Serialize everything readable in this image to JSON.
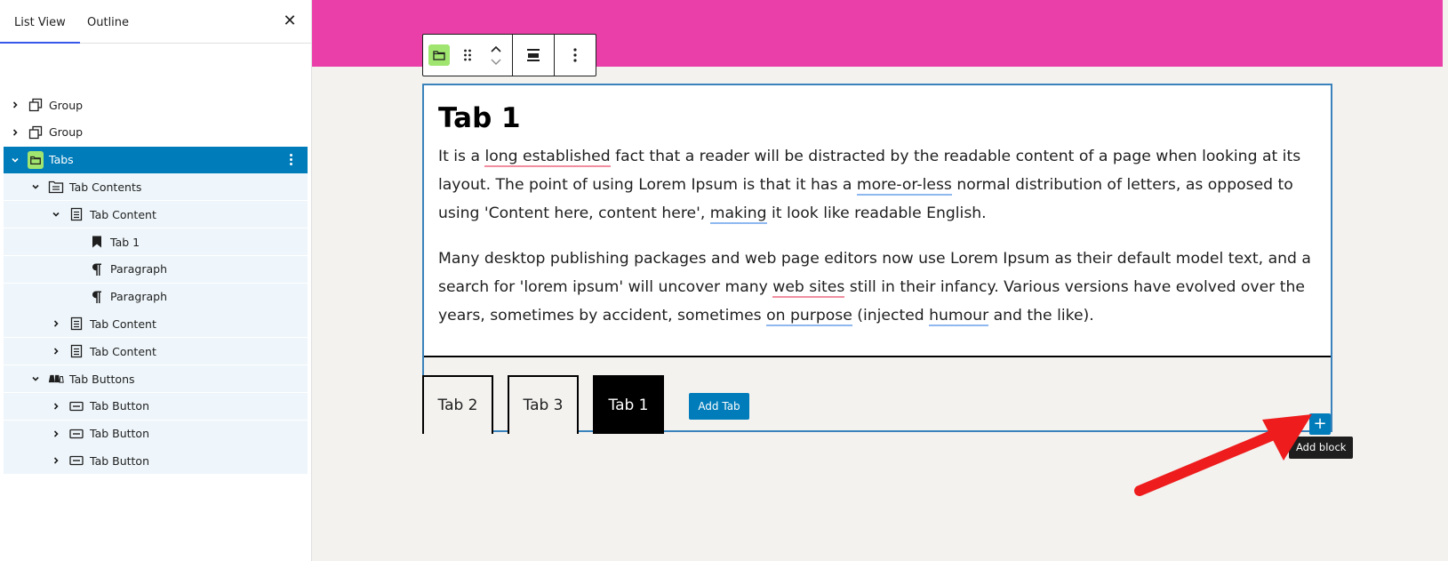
{
  "sidebar": {
    "tabs": [
      {
        "label": "List View",
        "active": true
      },
      {
        "label": "Outline",
        "active": false
      }
    ],
    "close_icon": "close-icon",
    "tree": [
      {
        "label": "Group",
        "icon": "group-icon",
        "chevron": "right",
        "level": 0
      },
      {
        "label": "Group",
        "icon": "group-icon",
        "chevron": "right",
        "level": 0
      },
      {
        "label": "Tabs",
        "icon": "tabs-block-icon",
        "chevron": "down",
        "level": 0,
        "selected": true
      },
      {
        "label": "Tab Contents",
        "icon": "tab-contents-icon",
        "chevron": "down",
        "level": 1
      },
      {
        "label": "Tab Content",
        "icon": "tab-content-icon",
        "chevron": "down",
        "level": 2
      },
      {
        "label": "Tab 1",
        "icon": "bookmark-icon",
        "chevron": "",
        "level": 3
      },
      {
        "label": "Paragraph",
        "icon": "paragraph-icon",
        "chevron": "",
        "level": 3
      },
      {
        "label": "Paragraph",
        "icon": "paragraph-icon",
        "chevron": "",
        "level": 3
      },
      {
        "label": "Tab Content",
        "icon": "tab-content-icon",
        "chevron": "right",
        "level": 2
      },
      {
        "label": "Tab Content",
        "icon": "tab-content-icon",
        "chevron": "right",
        "level": 2
      },
      {
        "label": "Tab Buttons",
        "icon": "tab-buttons-icon",
        "chevron": "down",
        "level": 1
      },
      {
        "label": "Tab Button",
        "icon": "tab-button-icon",
        "chevron": "right",
        "level": 2
      },
      {
        "label": "Tab Button",
        "icon": "tab-button-icon",
        "chevron": "right",
        "level": 2
      },
      {
        "label": "Tab Button",
        "icon": "tab-button-icon",
        "chevron": "right",
        "level": 2
      }
    ]
  },
  "toolbar": {
    "block_icon": "tabs-block-icon",
    "drag_icon": "drag-handle-icon",
    "move_icon": "move-up-down-icon",
    "align_icon": "align-icon",
    "options_icon": "more-options-icon"
  },
  "editor": {
    "heading": "Tab 1",
    "paragraphs": [
      [
        {
          "t": "It is a "
        },
        {
          "t": "long established",
          "sp": "red"
        },
        {
          "t": " fact that a reader will be distracted by the readable content of a page when looking at its layout. The point of using Lorem Ipsum is that it has a "
        },
        {
          "t": "more-or-less",
          "sp": "blue"
        },
        {
          "t": " normal distribution of letters, as opposed to using 'Content here, content here', "
        },
        {
          "t": "making",
          "sp": "blue"
        },
        {
          "t": " it look like readable English."
        }
      ],
      [
        {
          "t": "Many desktop publishing packages and web page editors now use Lorem Ipsum as their default model text, and a search for 'lorem ipsum' will uncover many "
        },
        {
          "t": "web sites",
          "sp": "red"
        },
        {
          "t": " still in their infancy. Various versions have evolved over the years, sometimes by accident, sometimes "
        },
        {
          "t": "on purpose",
          "sp": "blue"
        },
        {
          "t": " (injected "
        },
        {
          "t": "humour",
          "sp": "blue"
        },
        {
          "t": " and the like)."
        }
      ]
    ],
    "tab_buttons": [
      {
        "label": "Tab 2",
        "active": false
      },
      {
        "label": "Tab 3",
        "active": false
      },
      {
        "label": "Tab 1",
        "active": true
      }
    ],
    "add_tab_label": "Add Tab",
    "add_block_tooltip": "Add block",
    "add_block_symbol": "+"
  },
  "colors": {
    "accent": "#007cba",
    "header_bar": "#ea3ea8",
    "block_icon_bg": "#a0e56f",
    "canvas_bg": "#f3f2ef",
    "arrow": "#ee1c1c"
  }
}
